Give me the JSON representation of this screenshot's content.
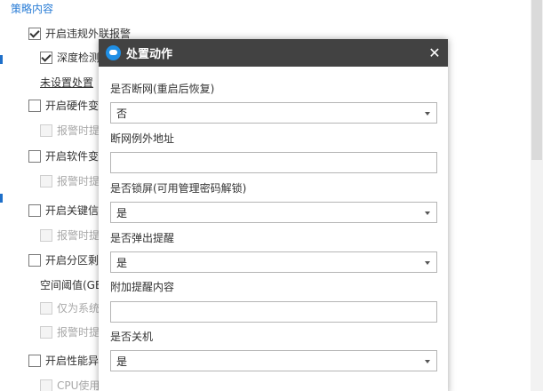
{
  "section": {
    "title": "策略内容"
  },
  "policies": [
    {
      "label": "开启违规外联报警",
      "checked": true,
      "disabled": false
    },
    {
      "label": "深度检测",
      "checked": true,
      "disabled": false
    },
    {
      "label": "未设置处置",
      "link": true
    },
    {
      "label": "开启硬件变",
      "checked": false,
      "disabled": false
    },
    {
      "label": "报警时提",
      "checked": false,
      "disabled": true
    },
    {
      "label": "开启软件变",
      "checked": false,
      "disabled": false
    },
    {
      "label": "报警时提",
      "checked": false,
      "disabled": true
    },
    {
      "label": "开启关键信",
      "checked": false,
      "disabled": false
    },
    {
      "label": "报警时提",
      "checked": false,
      "disabled": true
    },
    {
      "label": "开启分区剩",
      "checked": false,
      "disabled": false
    },
    {
      "label": "空间阈值(GE",
      "plain": true
    },
    {
      "label": "仅为系统",
      "checked": false,
      "disabled": true
    },
    {
      "label": "报警时提",
      "checked": false,
      "disabled": true
    },
    {
      "label": "开启性能异",
      "checked": false,
      "disabled": false
    },
    {
      "label": "CPU使用",
      "checked": false,
      "disabled": true
    }
  ],
  "dialog": {
    "title": "处置动作",
    "close_glyph": "✕",
    "fields": {
      "disconnect": {
        "label": "是否断网(重启后恢复)",
        "value": "否"
      },
      "exception": {
        "label": "断网例外地址",
        "value": ""
      },
      "lock": {
        "label": "是否锁屏(可用管理密码解锁)",
        "value": "是"
      },
      "popup": {
        "label": "是否弹出提醒",
        "value": "是"
      },
      "extra": {
        "label": "附加提醒内容",
        "value": ""
      },
      "shutdown": {
        "label": "是否关机",
        "value": "是"
      }
    }
  },
  "colors": {
    "accent": "#2a7dd6",
    "header": "#424242",
    "logo": "#1f8fe5"
  }
}
